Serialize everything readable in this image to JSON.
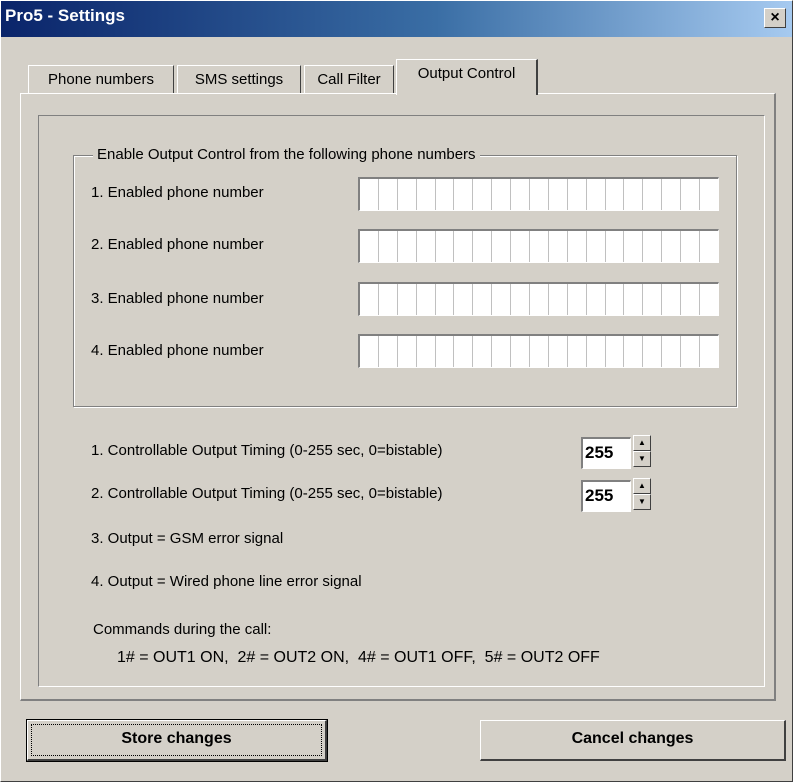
{
  "window": {
    "title": "Pro5 - Settings",
    "close_glyph": "×"
  },
  "tabs": [
    {
      "label": "Phone numbers",
      "active": false
    },
    {
      "label": "SMS settings",
      "active": false
    },
    {
      "label": "Call Filter",
      "active": false
    },
    {
      "label": "Output Control",
      "active": true
    }
  ],
  "group": {
    "title": "Enable Output Control from the following phone numbers",
    "phones": [
      {
        "label": "1. Enabled phone number",
        "value": ""
      },
      {
        "label": "2. Enabled phone number",
        "value": ""
      },
      {
        "label": "3. Enabled phone number",
        "value": ""
      },
      {
        "label": "4. Enabled phone number",
        "value": ""
      }
    ]
  },
  "timing": [
    {
      "label": "1. Controllable Output Timing (0-255 sec, 0=bistable)",
      "value": "255"
    },
    {
      "label": "2. Controllable Output Timing (0-255 sec, 0=bistable)",
      "value": "255"
    }
  ],
  "outputs": {
    "output3": "3. Output = GSM error signal",
    "output4": "4. Output = Wired phone line error signal"
  },
  "commands": {
    "heading": "Commands during the call:",
    "text": "1# = OUT1 ON,  2# = OUT2 ON,  4# = OUT1 OFF,  5# = OUT2 OFF"
  },
  "buttons": {
    "store": "Store changes",
    "cancel": "Cancel changes"
  },
  "icons": {
    "spin_up": "up-arrow-icon",
    "spin_down": "down-arrow-icon",
    "close": "close-icon"
  }
}
